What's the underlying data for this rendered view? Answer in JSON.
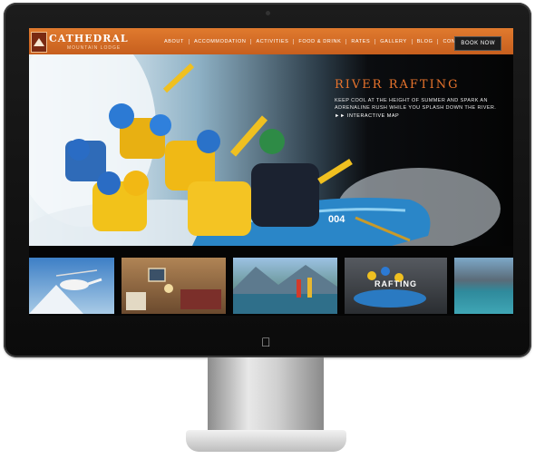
{
  "site": {
    "brand": "CATHEDRAL",
    "brand_sub": "MOUNTAIN LODGE",
    "nav": [
      "ABOUT",
      "ACCOMMODATION",
      "ACTIVITIES",
      "FOOD & DRINK",
      "RATES",
      "GALLERY",
      "BLOG",
      "CONTACT"
    ],
    "cta": "BOOK NOW"
  },
  "hero": {
    "title": "RIVER RAFTING",
    "copy": "KEEP COOL AT THE HEIGHT OF SUMMER AND SPARK AN ADRENALINE RUSH WHILE YOU SPLASH DOWN THE RIVER.",
    "link": "►► INTERACTIVE MAP",
    "raft_number": "004"
  },
  "thumbnails": {
    "active_label": "RAFTING"
  },
  "colors": {
    "accent": "#e07a2e",
    "header_dark": "#c75f1e",
    "title_orange": "#e9742c"
  },
  "icons": {
    "device_logo": "apple-logo-icon"
  }
}
